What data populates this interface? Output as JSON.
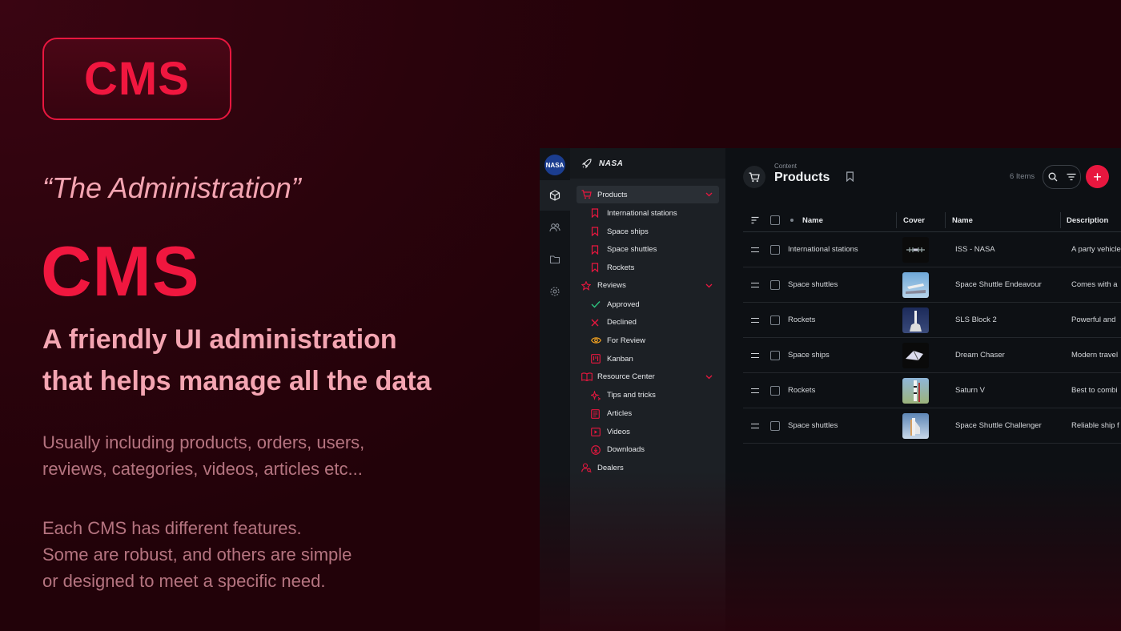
{
  "hero": {
    "badge": "CMS",
    "subtitle": "“The Administration”",
    "title": "CMS",
    "tagline_line1": "A friendly UI administration",
    "tagline_line2": "that helps manage all the data",
    "para1_line1": "Usually including products, orders, users,",
    "para1_line2": "reviews, categories, videos, articles etc...",
    "para2_line1": "Each CMS has different features.",
    "para2_line2": "Some are robust, and others are simple",
    "para2_line3": "or designed to meet a specific need."
  },
  "app": {
    "rail": {
      "logo": "NASA",
      "icons": [
        "cube-icon",
        "users-icon",
        "folder-icon",
        "gear-icon"
      ]
    },
    "sidebar": {
      "brand": "NASA",
      "groups": [
        {
          "label": "Products",
          "icon": "cart-icon",
          "items": [
            {
              "label": "International stations",
              "icon": "bookmark-icon"
            },
            {
              "label": "Space ships",
              "icon": "bookmark-icon"
            },
            {
              "label": "Space shuttles",
              "icon": "bookmark-icon"
            },
            {
              "label": "Rockets",
              "icon": "bookmark-icon"
            }
          ]
        },
        {
          "label": "Reviews",
          "icon": "star-icon",
          "items": [
            {
              "label": "Approved",
              "icon": "check-icon"
            },
            {
              "label": "Declined",
              "icon": "x-icon"
            },
            {
              "label": "For Review",
              "icon": "eye-icon"
            },
            {
              "label": "Kanban",
              "icon": "kanban-icon"
            }
          ]
        },
        {
          "label": "Resource Center",
          "icon": "book-icon",
          "items": [
            {
              "label": "Tips and tricks",
              "icon": "sparkle-icon"
            },
            {
              "label": "Articles",
              "icon": "article-icon"
            },
            {
              "label": "Videos",
              "icon": "video-icon"
            },
            {
              "label": "Downloads",
              "icon": "download-icon"
            }
          ]
        },
        {
          "label": "Dealers",
          "icon": "dealer-icon",
          "items": []
        }
      ]
    },
    "main": {
      "crumb": "Content",
      "title": "Products",
      "items_count": "6 Items",
      "columns": [
        "Name",
        "Cover",
        "Name",
        "Description"
      ],
      "rows": [
        {
          "category": "International stations",
          "name": "ISS - NASA",
          "description": "A party vehicle"
        },
        {
          "category": "Space shuttles",
          "name": "Space Shuttle Endeavour",
          "description": "Comes with a"
        },
        {
          "category": "Rockets",
          "name": "SLS Block 2",
          "description": "Powerful and"
        },
        {
          "category": "Space ships",
          "name": "Dream Chaser",
          "description": "Modern travel"
        },
        {
          "category": "Rockets",
          "name": "Saturn V",
          "description": "Best to combi"
        },
        {
          "category": "Space shuttles",
          "name": "Space Shuttle Challenger",
          "description": "Reliable ship f"
        }
      ]
    },
    "colors": {
      "accent": "#e8173f",
      "background": "#2a030c",
      "panel": "#1c2025"
    }
  }
}
